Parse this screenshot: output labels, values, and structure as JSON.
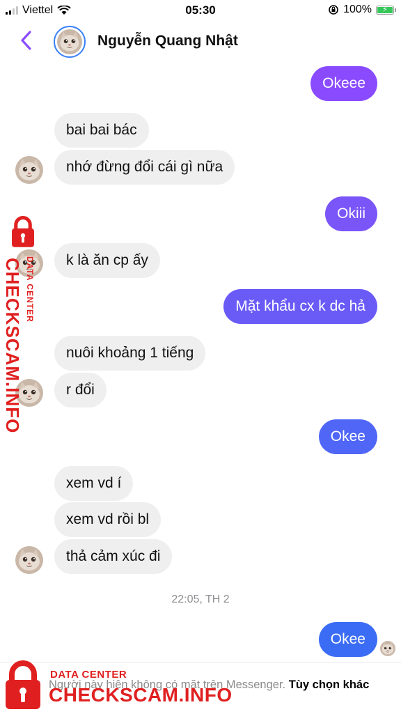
{
  "status_bar": {
    "carrier": "Viettel",
    "time": "05:30",
    "battery": "100%"
  },
  "header": {
    "contact_name": "Nguyễn Quang Nhật"
  },
  "messages": [
    {
      "dir": "out",
      "text": "Okeee"
    },
    {
      "dir": "in",
      "text": "bai bai bác"
    },
    {
      "dir": "in",
      "text": "nhớ đừng đổi cái gì nữa"
    },
    {
      "dir": "out",
      "text": "Okiii"
    },
    {
      "dir": "in",
      "text": "k là ăn cp ấy"
    },
    {
      "dir": "out",
      "text": "Mặt khẩu cx k dc hả"
    },
    {
      "dir": "in",
      "text": "nuôi khoảng 1 tiếng"
    },
    {
      "dir": "in",
      "text": "r đổi"
    },
    {
      "dir": "out",
      "text": "Okee"
    },
    {
      "dir": "in",
      "text": "xem vd í"
    },
    {
      "dir": "in",
      "text": "xem vd rồi bl"
    },
    {
      "dir": "in",
      "text": "thả cảm xúc đi"
    },
    {
      "dir": "out",
      "text": "Okee"
    }
  ],
  "timestamp": "22:05, TH 2",
  "footer": {
    "notice": "Người này hiện không có mặt trên Messenger.",
    "more_options": "Tùy chọn khác"
  },
  "watermark": {
    "line1": "DATA CENTER",
    "line2": "CHECKSCAM.INFO"
  },
  "colors": {
    "accent": "#8a4bff",
    "incoming_bubble": "#efefef",
    "outgoing_top": "#8a4bff",
    "outgoing_bottom": "#3b6cf5",
    "watermark": "#e02020"
  }
}
